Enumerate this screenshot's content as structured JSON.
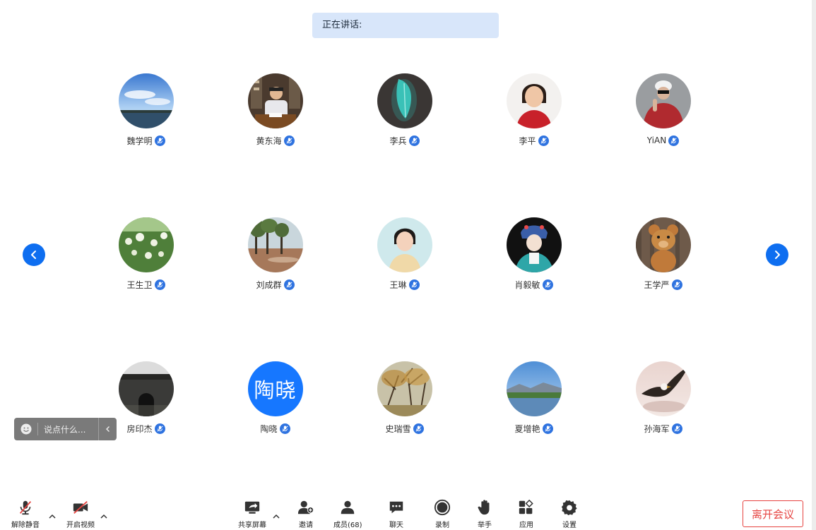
{
  "speaking": {
    "label": "正在讲话:"
  },
  "participants": [
    {
      "name": "魏学明",
      "avatar": "sky-lake-photo"
    },
    {
      "name": "黄东海",
      "avatar": "man-at-desk-photo"
    },
    {
      "name": "李兵",
      "avatar": "teal-feather-photo"
    },
    {
      "name": "李平",
      "avatar": "woman-red-jacket-photo"
    },
    {
      "name": "YiAN",
      "avatar": "person-white-cap-photo"
    },
    {
      "name": "王生卫",
      "avatar": "white-flowers-photo"
    },
    {
      "name": "刘成群",
      "avatar": "trees-flood-photo"
    },
    {
      "name": "王琳",
      "avatar": "woman-smiling-photo"
    },
    {
      "name": "肖毅敏",
      "avatar": "opera-costume-photo"
    },
    {
      "name": "王学严",
      "avatar": "teddy-bear-photo"
    },
    {
      "name": "房印杰",
      "avatar": "city-gate-photo"
    },
    {
      "name": "陶晓",
      "avatar_text": "陶晓"
    },
    {
      "name": "史瑞雪",
      "avatar": "autumn-trees-photo"
    },
    {
      "name": "夏增艳",
      "avatar": "lake-mountain-photo"
    },
    {
      "name": "孙海军",
      "avatar": "eagle-photo"
    }
  ],
  "chat": {
    "placeholder": "说点什么..."
  },
  "toolbar": {
    "unmute": "解除静音",
    "start_video": "开启视频",
    "share_screen": "共享屏幕",
    "invite": "邀请",
    "members": "成员(68)",
    "chat": "聊天",
    "record": "录制",
    "raise_hand": "举手",
    "apps": "应用",
    "settings": "设置",
    "leave": "离开会议"
  },
  "colors": {
    "accent": "#0e6ef0",
    "speaking_bg": "#d8e6fa",
    "leave": "#e64340",
    "mute_red": "#e64340"
  }
}
